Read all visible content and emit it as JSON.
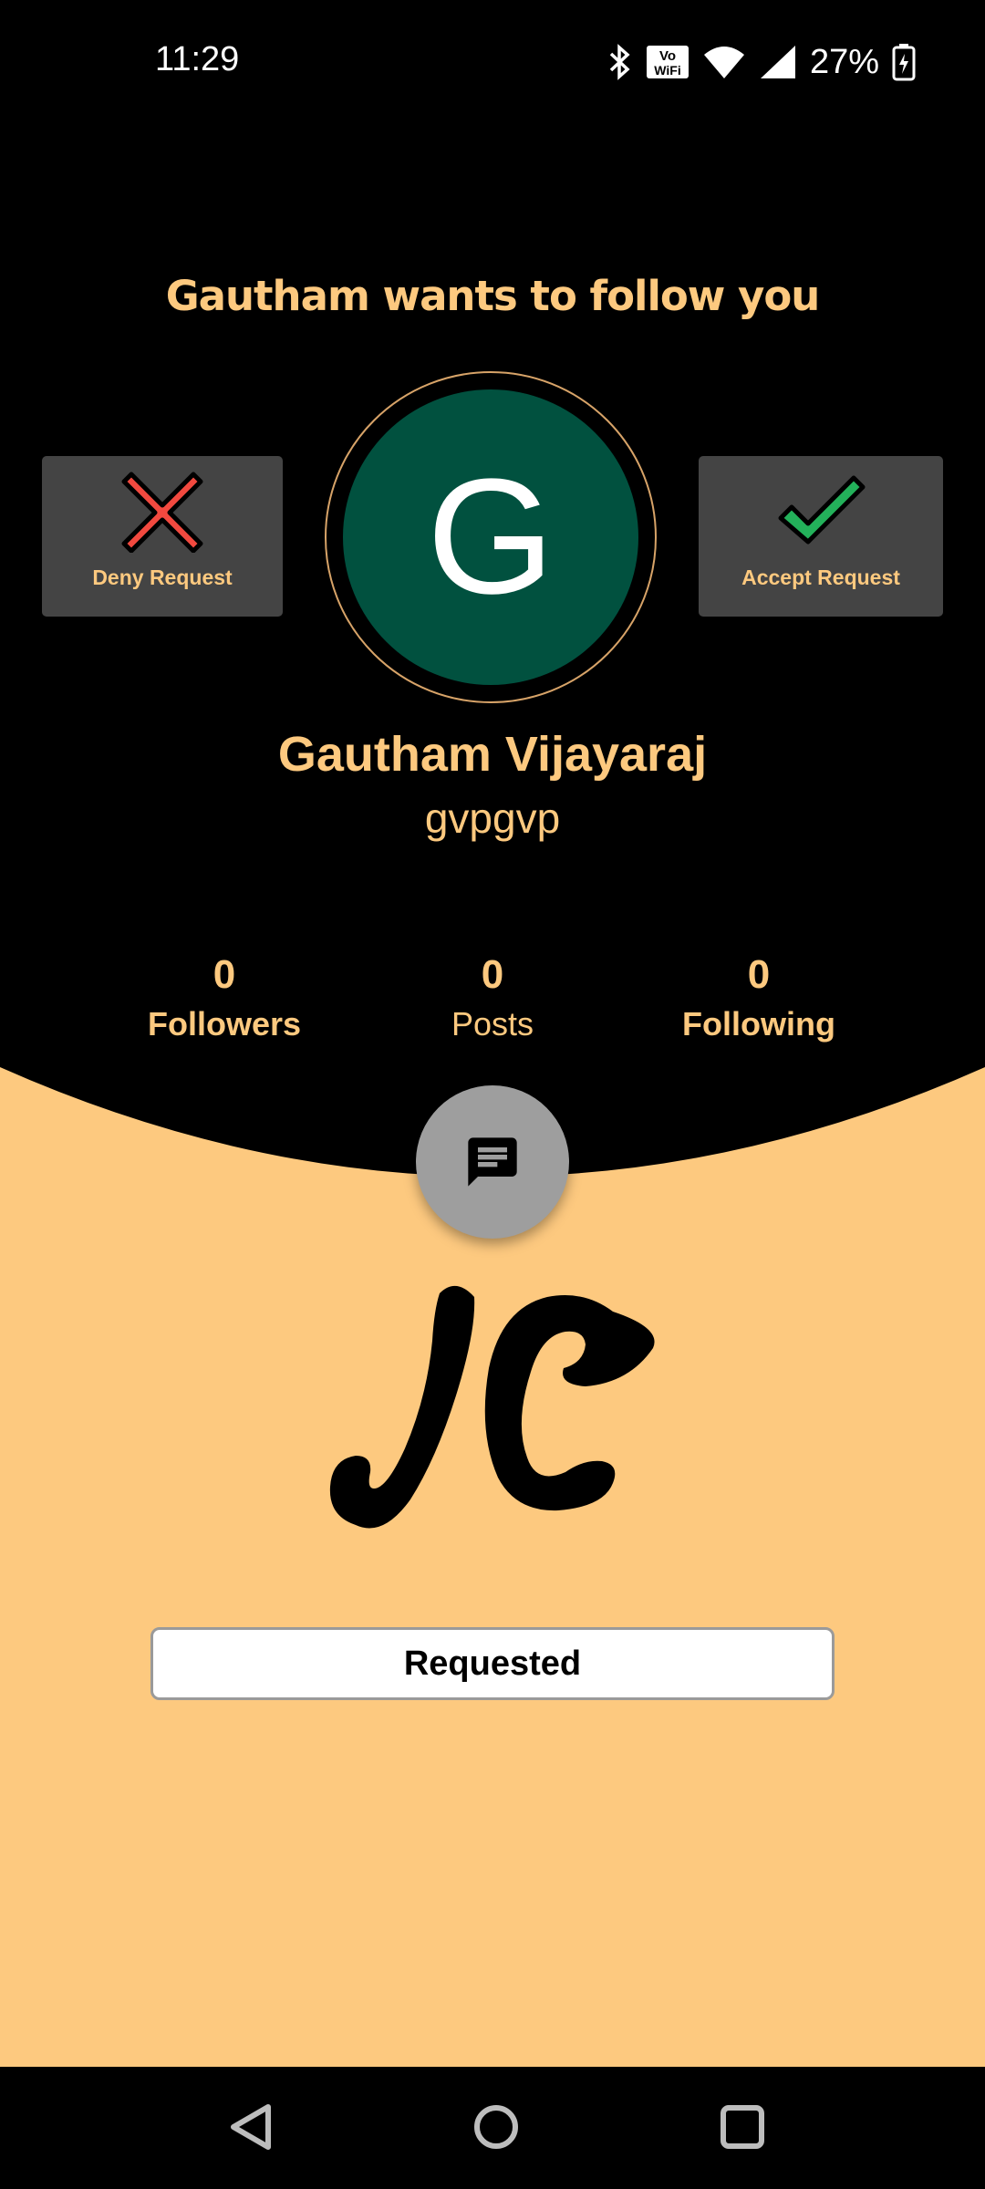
{
  "status_bar": {
    "time": "11:29",
    "battery_percent": "27%",
    "icons": [
      "bluetooth-icon",
      "vowifi-icon",
      "wifi-icon",
      "signal-icon",
      "battery-charging-icon"
    ]
  },
  "request": {
    "headline": "Gautham wants to follow you",
    "deny_label": "Deny Request",
    "accept_label": "Accept Request"
  },
  "profile": {
    "avatar_letter": "G",
    "display_name": "Gautham Vijayaraj",
    "username": "gvpgvp",
    "stats": {
      "followers_count": "0",
      "followers_label": "Followers",
      "posts_count": "0",
      "posts_label": "Posts",
      "following_count": "0",
      "following_label": "Following"
    }
  },
  "actions": {
    "chat_icon": "chat-icon",
    "follow_state_label": "Requested"
  },
  "nav": {
    "icons": [
      "back-icon",
      "home-icon",
      "recents-icon"
    ]
  },
  "colors": {
    "accent": "#fdc97f",
    "background_top": "#000000",
    "background_bottom": "#fdc97f",
    "avatar_bg": "#01513f",
    "button_bg": "#444444"
  }
}
